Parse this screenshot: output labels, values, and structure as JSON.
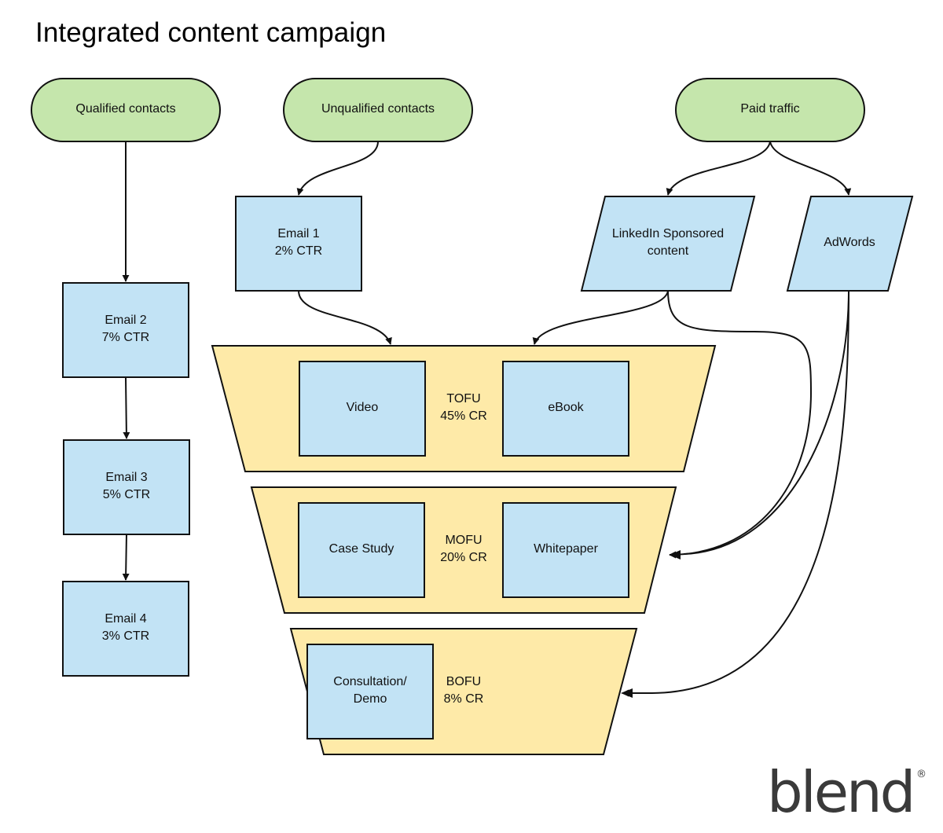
{
  "title": "Integrated content campaign",
  "colors": {
    "source_fill": "#c5e6ac",
    "box_fill": "#c2e3f5",
    "funnel_fill": "#feeaa8",
    "stroke": "#111111",
    "logo": "#3a3a3a"
  },
  "sources": {
    "qualified": "Qualified contacts",
    "unqualified": "Unqualified contacts",
    "paid": "Paid traffic"
  },
  "emails": [
    {
      "name": "Email 1",
      "metric": "2% CTR"
    },
    {
      "name": "Email 2",
      "metric": "7% CTR"
    },
    {
      "name": "Email 3",
      "metric": "5% CTR"
    },
    {
      "name": "Email 4",
      "metric": "3% CTR"
    }
  ],
  "paid_channels": {
    "linkedin": [
      "LinkedIn Sponsored",
      "content"
    ],
    "adwords": "AdWords"
  },
  "funnel": {
    "tofu": {
      "stage": "TOFU",
      "rate": "45% CR",
      "items": [
        "Video",
        "eBook"
      ]
    },
    "mofu": {
      "stage": "MOFU",
      "rate": "20% CR",
      "items": [
        "Case Study",
        "Whitepaper"
      ]
    },
    "bofu": {
      "stage": "BOFU",
      "rate": "8% CR",
      "items": [
        [
          "Consultation/",
          "Demo"
        ]
      ]
    }
  },
  "logo": {
    "text": "blend",
    "mark": "®"
  }
}
